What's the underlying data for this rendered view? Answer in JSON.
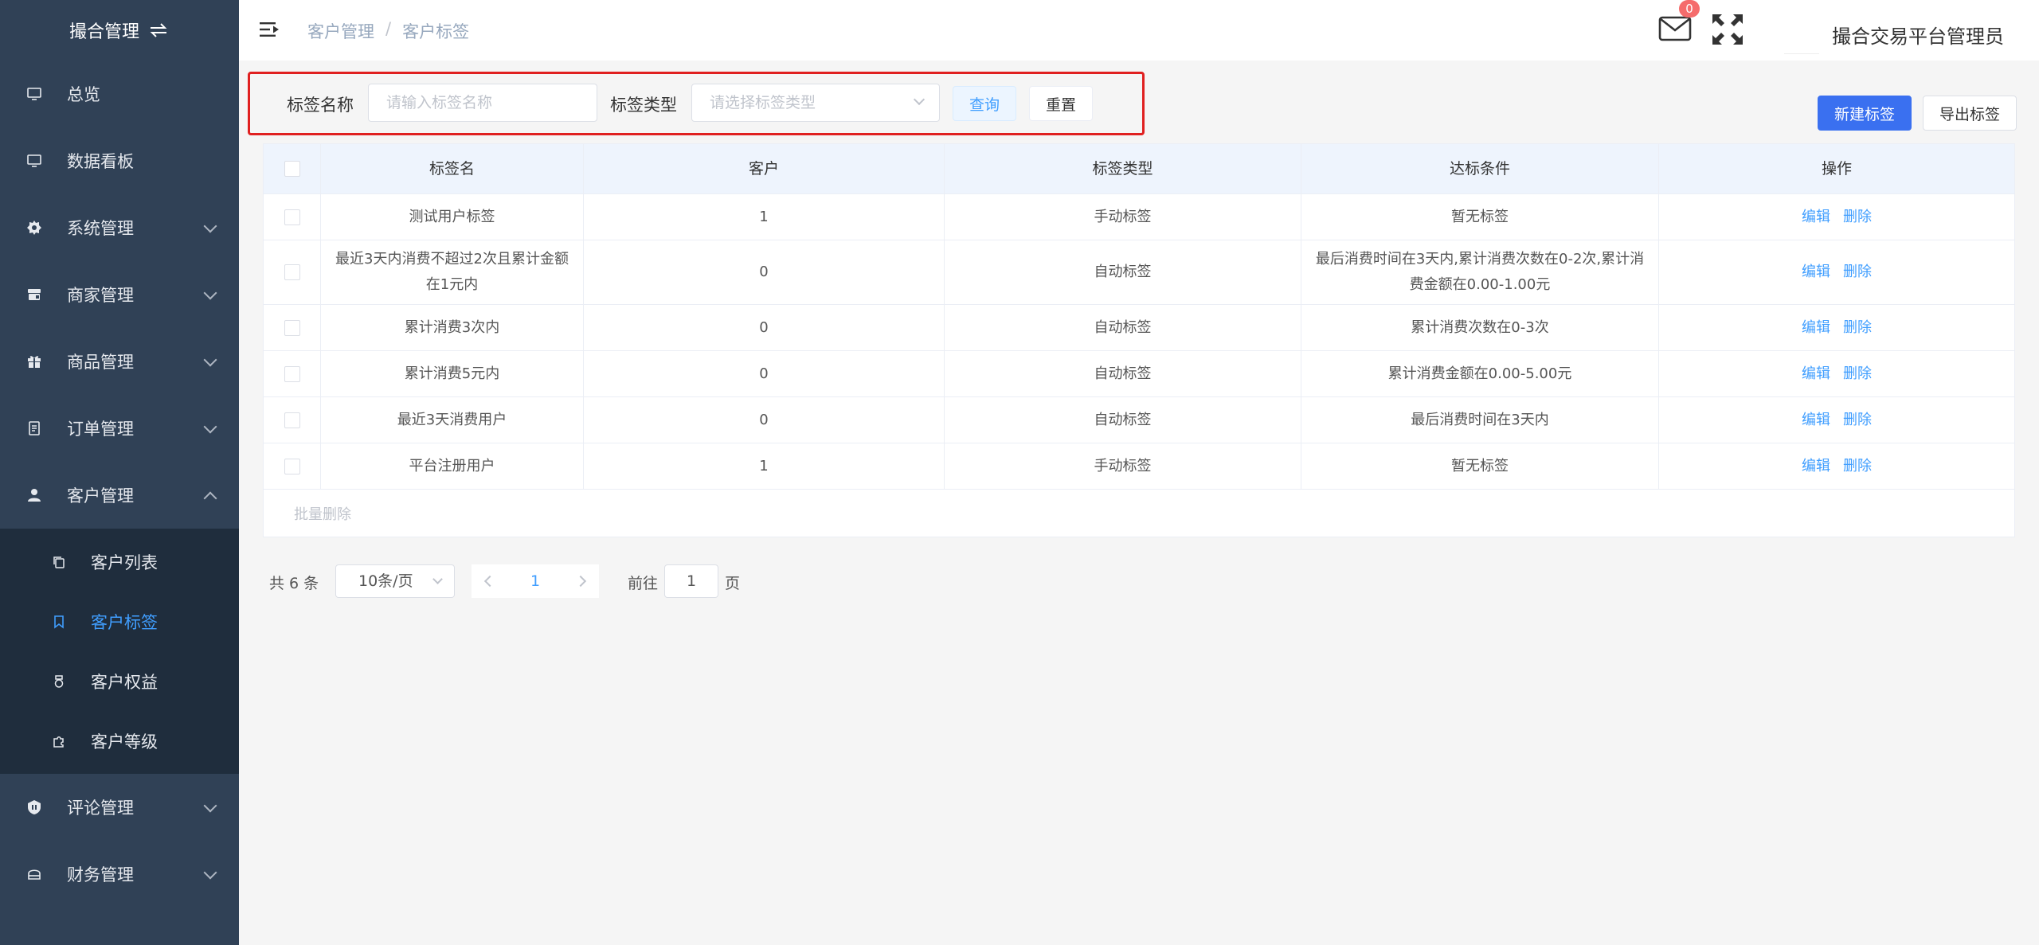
{
  "sidebar": {
    "brand": "撮合管理",
    "items": [
      {
        "label": "总览",
        "icon": "monitor-icon"
      },
      {
        "label": "数据看板",
        "icon": "monitor-icon"
      },
      {
        "label": "系统管理",
        "icon": "gear-icon"
      },
      {
        "label": "商家管理",
        "icon": "store-icon"
      },
      {
        "label": "商品管理",
        "icon": "gift-icon"
      },
      {
        "label": "订单管理",
        "icon": "document-icon"
      },
      {
        "label": "客户管理",
        "icon": "user-icon"
      },
      {
        "label": "评论管理",
        "icon": "shield-icon"
      },
      {
        "label": "财务管理",
        "icon": "wallet-icon"
      }
    ],
    "sub_items": [
      {
        "label": "客户列表",
        "icon": "copy-icon"
      },
      {
        "label": "客户标签",
        "icon": "bookmark-icon"
      },
      {
        "label": "客户权益",
        "icon": "medal-icon"
      },
      {
        "label": "客户等级",
        "icon": "puzzle-icon"
      }
    ]
  },
  "header": {
    "breadcrumb": [
      "客户管理",
      "客户标签"
    ],
    "separator": "/",
    "mail_badge": "0",
    "username": "撮合交易平台管理员"
  },
  "filter": {
    "name_label": "标签名称",
    "name_placeholder": "请输入标签名称",
    "type_label": "标签类型",
    "type_placeholder": "请选择标签类型",
    "query_button": "查询",
    "reset_button": "重置"
  },
  "actions": {
    "new_button": "新建标签",
    "export_button": "导出标签"
  },
  "table": {
    "columns": [
      "标签名",
      "客户",
      "标签类型",
      "达标条件",
      "操作"
    ],
    "rows": [
      {
        "name": "测试用户标签",
        "customers": "1",
        "type": "手动标签",
        "condition": "暂无标签"
      },
      {
        "name": "最近3天内消费不超过2次且累计金额在1元内",
        "customers": "0",
        "type": "自动标签",
        "condition": "最后消费时间在3天内,累计消费次数在0-2次,累计消费金额在0.00-1.00元"
      },
      {
        "name": "累计消费3次内",
        "customers": "0",
        "type": "自动标签",
        "condition": "累计消费次数在0-3次"
      },
      {
        "name": "累计消费5元内",
        "customers": "0",
        "type": "自动标签",
        "condition": "累计消费金额在0.00-5.00元"
      },
      {
        "name": "最近3天消费用户",
        "customers": "0",
        "type": "自动标签",
        "condition": "最后消费时间在3天内"
      },
      {
        "name": "平台注册用户",
        "customers": "1",
        "type": "手动标签",
        "condition": "暂无标签"
      }
    ],
    "edit_label": "编辑",
    "delete_label": "删除",
    "batch_delete": "批量删除"
  },
  "pagination": {
    "total": "共 6 条",
    "page_size": "10条/页",
    "current_page": "1",
    "goto_label": "前往",
    "goto_value": "1",
    "page_suffix": "页"
  },
  "colors": {
    "sidebar_bg": "#304156",
    "submenu_bg": "#1f2d3d",
    "active": "#409eff",
    "primary": "#3a70f0",
    "highlight_border": "#e02020",
    "badge": "#f56c6c"
  }
}
